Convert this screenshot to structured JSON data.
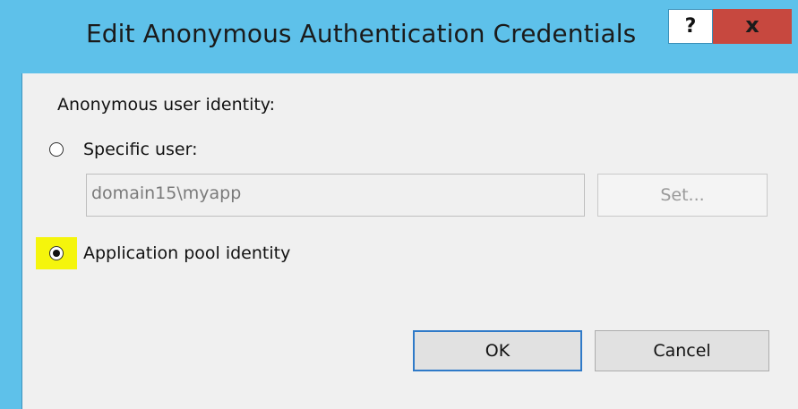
{
  "dialog": {
    "title": "Edit Anonymous Authentication Credentials",
    "help_label": "?",
    "close_label": "x",
    "identity_label": "Anonymous user identity:",
    "specific_user": {
      "label": "Specific user:",
      "selected": false,
      "field_value": "domain15\\myapp",
      "set_button_label": "Set..."
    },
    "app_pool": {
      "label": "Application pool identity",
      "selected": true
    },
    "buttons": {
      "ok_label": "OK",
      "cancel_label": "Cancel"
    }
  },
  "colors": {
    "titlebar": "#5ec1ea",
    "close_button": "#c7483f",
    "client_background": "#f0f0f0",
    "highlight": "#f5f50c",
    "ok_border": "#2f7ac8"
  },
  "icons": {
    "help": "question-mark-icon",
    "close": "close-icon"
  }
}
